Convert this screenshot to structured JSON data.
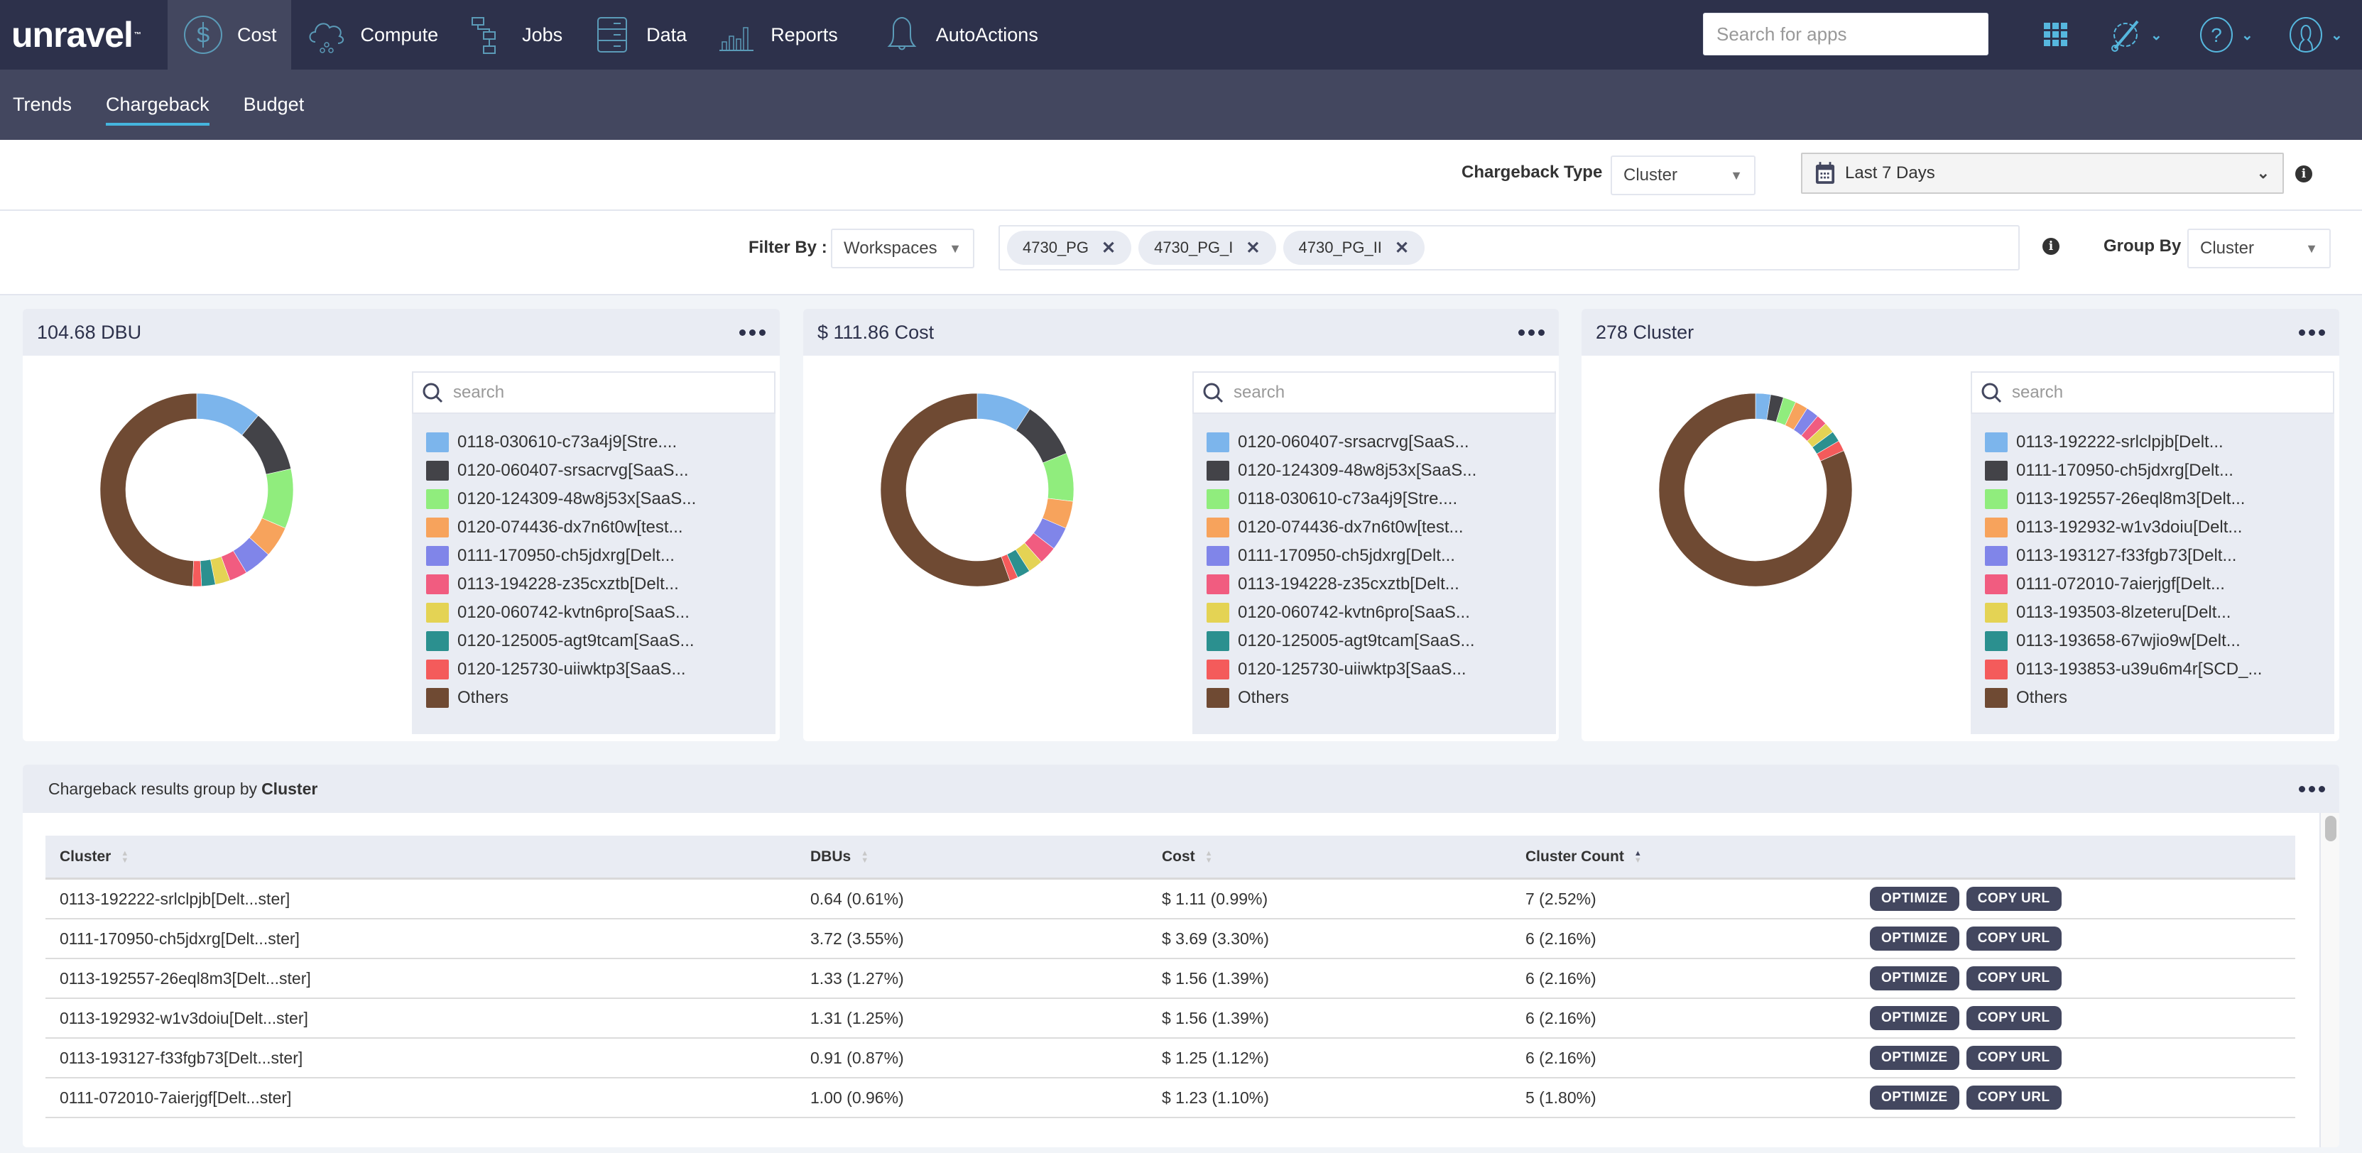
{
  "app": {
    "logo": "unravel"
  },
  "nav": {
    "items": [
      {
        "label": "Cost",
        "icon": "dollar-circle-icon",
        "active": true
      },
      {
        "label": "Compute",
        "icon": "cloud-icon",
        "active": false
      },
      {
        "label": "Jobs",
        "icon": "workflow-icon",
        "active": false
      },
      {
        "label": "Data",
        "icon": "database-icon",
        "active": false
      },
      {
        "label": "Reports",
        "icon": "bar-chart-icon",
        "active": false
      },
      {
        "label": "AutoActions",
        "icon": "bell-icon",
        "active": false
      }
    ],
    "search_placeholder": "Search for apps",
    "right_icons": [
      "apps-grid-icon",
      "settings-wrench-icon",
      "help-icon",
      "user-icon"
    ]
  },
  "subnav": {
    "tabs": [
      {
        "label": "Trends",
        "active": false
      },
      {
        "label": "Chargeback",
        "active": true
      },
      {
        "label": "Budget",
        "active": false
      }
    ]
  },
  "controls": {
    "chargeback_type_label": "Chargeback Type",
    "chargeback_type_value": "Cluster",
    "date_range": "Last 7 Days",
    "filter_by_label": "Filter By :",
    "filter_by_value": "Workspaces",
    "filter_tags": [
      "4730_PG",
      "4730_PG_I",
      "4730_PG_II"
    ],
    "group_by_label": "Group By",
    "group_by_value": "Cluster"
  },
  "legend_search_placeholder": "search",
  "colors": [
    "#7cb5ec",
    "#434348",
    "#90ed7d",
    "#f7a35c",
    "#8085e9",
    "#f15c80",
    "#e4d354",
    "#2b908f",
    "#f45b5b",
    "#6f4a33"
  ],
  "chart_data": [
    {
      "type": "pie",
      "title": "104.68 DBU",
      "categories": [
        "0118-030610-c73a4j9[Stre....",
        "0120-060407-srsacrvg[SaaS...",
        "0120-124309-48w8j53x[SaaS...",
        "0120-074436-dx7n6t0w[test...",
        "0111-170950-ch5jdxrg[Delt...",
        "0113-194228-z35cxztb[Delt...",
        "0120-060742-kvtn6pro[SaaS...",
        "0120-125005-agt9tcam[SaaS...",
        "0120-125730-uiiwktp3[SaaS...",
        "Others"
      ],
      "values": [
        11.0,
        10.5,
        10.0,
        5.2,
        4.7,
        3.0,
        2.5,
        2.3,
        1.5,
        49.3
      ]
    },
    {
      "type": "pie",
      "title": "$ 111.86 Cost",
      "categories": [
        "0120-060407-srsacrvg[SaaS...",
        "0120-124309-48w8j53x[SaaS...",
        "0118-030610-c73a4j9[Stre....",
        "0120-074436-dx7n6t0w[test...",
        "0111-170950-ch5jdxrg[Delt...",
        "0113-194228-z35cxztb[Delt...",
        "0120-060742-kvtn6pro[SaaS...",
        "0120-125005-agt9tcam[SaaS...",
        "0120-125730-uiiwktp3[SaaS...",
        "Others"
      ],
      "values": [
        9.2,
        9.6,
        8.1,
        4.6,
        3.9,
        3.0,
        2.5,
        2.2,
        1.4,
        55.5
      ]
    },
    {
      "type": "pie",
      "title": "278 Cluster",
      "categories": [
        "0113-192222-srlclpjb[Delt...",
        "0111-170950-ch5jdxrg[Delt...",
        "0113-192557-26eql8m3[Delt...",
        "0113-192932-w1v3doiu[Delt...",
        "0113-193127-f33fgb73[Delt...",
        "0111-072010-7aierjgf[Delt...",
        "0113-193503-8lzeteru[Delt...",
        "0113-193658-67wjio9w[Delt...",
        "0113-193853-u39u6m4r[SCD_...",
        "Others"
      ],
      "values": [
        7,
        6,
        6,
        6,
        6,
        5,
        5,
        5,
        5,
        227
      ]
    }
  ],
  "table": {
    "title_prefix": "Chargeback results group by",
    "title_group": "Cluster",
    "columns": [
      "Cluster",
      "DBUs",
      "Cost",
      "Cluster Count"
    ],
    "sorted_column": "Cluster Count",
    "optimize_label": "OPTIMIZE",
    "copy_url_label": "COPY URL",
    "rows": [
      {
        "cluster": "0113-192222-srlclpjb[Delt...ster]",
        "dbus": "0.64 (0.61%)",
        "cost": "$ 1.11 (0.99%)",
        "count": "7 (2.52%)"
      },
      {
        "cluster": "0111-170950-ch5jdxrg[Delt...ster]",
        "dbus": "3.72 (3.55%)",
        "cost": "$ 3.69 (3.30%)",
        "count": "6 (2.16%)"
      },
      {
        "cluster": "0113-192557-26eql8m3[Delt...ster]",
        "dbus": "1.33 (1.27%)",
        "cost": "$ 1.56 (1.39%)",
        "count": "6 (2.16%)"
      },
      {
        "cluster": "0113-192932-w1v3doiu[Delt...ster]",
        "dbus": "1.31 (1.25%)",
        "cost": "$ 1.56 (1.39%)",
        "count": "6 (2.16%)"
      },
      {
        "cluster": "0113-193127-f33fgb73[Delt...ster]",
        "dbus": "0.91 (0.87%)",
        "cost": "$ 1.25 (1.12%)",
        "count": "6 (2.16%)"
      },
      {
        "cluster": "0111-072010-7aierjgf[Delt...ster]",
        "dbus": "1.00 (0.96%)",
        "cost": "$ 1.23 (1.10%)",
        "count": "5 (1.80%)"
      }
    ]
  }
}
